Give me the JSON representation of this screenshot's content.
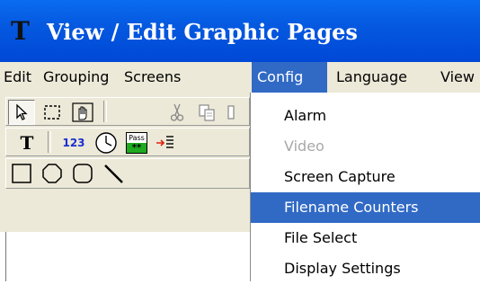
{
  "window": {
    "title": "View / Edit Graphic Pages",
    "app_icon_letter": "T"
  },
  "menubar": {
    "items": [
      "Edit",
      "Grouping",
      "Screens",
      "Config",
      "Language",
      "View"
    ],
    "active": "Config"
  },
  "toolbar": {
    "row1": [
      "pointer-icon",
      "marquee-select-icon",
      "hand-pan-icon",
      "cut-icon",
      "copy-icon"
    ],
    "row2": {
      "text_tool": "T",
      "numeric_tool": "123",
      "clock_icon": "clock-icon",
      "pass_label": "Pass",
      "pass_stars": "**",
      "list_icon": "arrow-list-icon"
    },
    "row3": [
      "rectangle-icon",
      "octagon-icon",
      "rounded-rect-icon",
      "line-icon"
    ]
  },
  "config_menu": {
    "items": [
      {
        "label": "Alarm",
        "enabled": true
      },
      {
        "label": "Video",
        "enabled": false
      },
      {
        "label": "Screen Capture",
        "enabled": true
      },
      {
        "label": "Filename Counters",
        "enabled": true,
        "highlighted": true
      },
      {
        "label": "File Select",
        "enabled": true
      },
      {
        "label": "Display Settings",
        "enabled": true
      }
    ]
  },
  "colors": {
    "title_bar": "#0055e5",
    "menu_highlight": "#316ac5",
    "chrome": "#ece9d8",
    "disabled_text": "#a8a8a8"
  }
}
